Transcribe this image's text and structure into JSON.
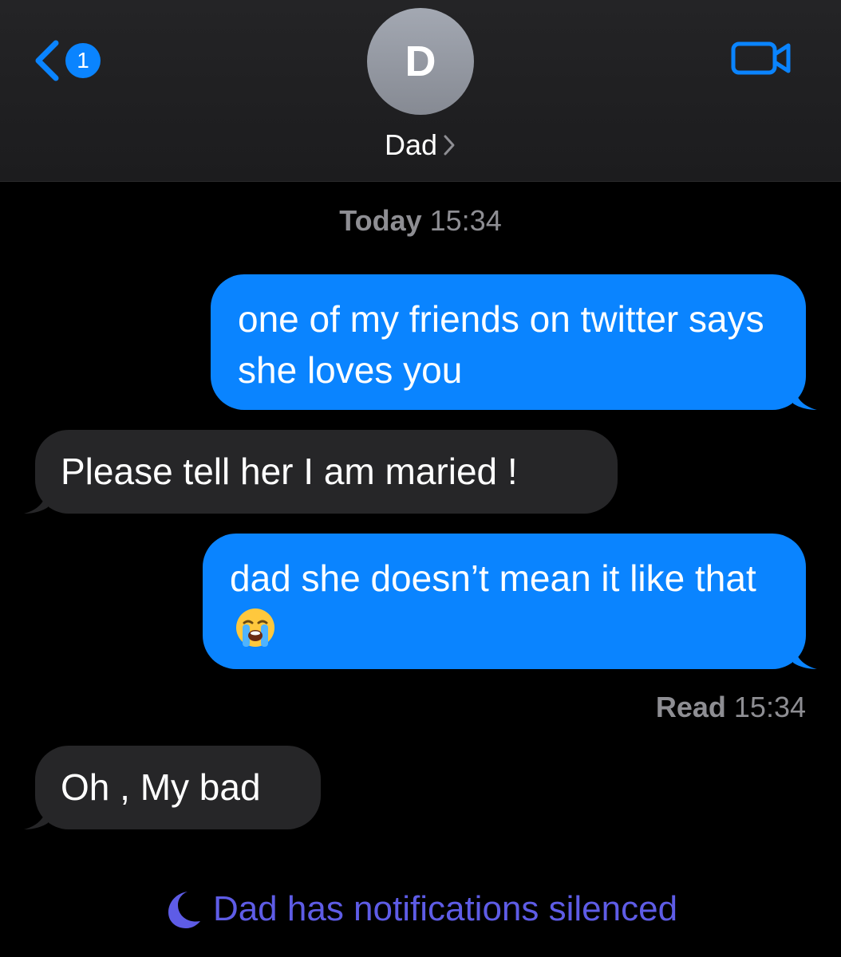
{
  "header": {
    "back_badge_count": "1",
    "avatar_initial": "D",
    "contact_name": "Dad"
  },
  "conversation": {
    "timestamp_day": "Today",
    "timestamp_time": "15:34",
    "messages": [
      {
        "direction": "outgoing",
        "text": "one of my friends on twitter says she loves you"
      },
      {
        "direction": "incoming",
        "text": "Please tell her I am maried !"
      },
      {
        "direction": "outgoing",
        "text": "dad she doesn’t mean it like that",
        "emoji": "loudly-crying-face"
      },
      {
        "direction": "incoming",
        "text": "Oh , My bad"
      }
    ],
    "read_label": "Read",
    "read_time": "15:34"
  },
  "footer": {
    "silenced_text": "Dad has notifications silenced"
  },
  "colors": {
    "accent": "#0a84ff",
    "outgoing_bubble": "#0a84ff",
    "incoming_bubble": "#262628",
    "secondary_text": "#8e8e93",
    "focus_purple": "#5e5ce6"
  }
}
